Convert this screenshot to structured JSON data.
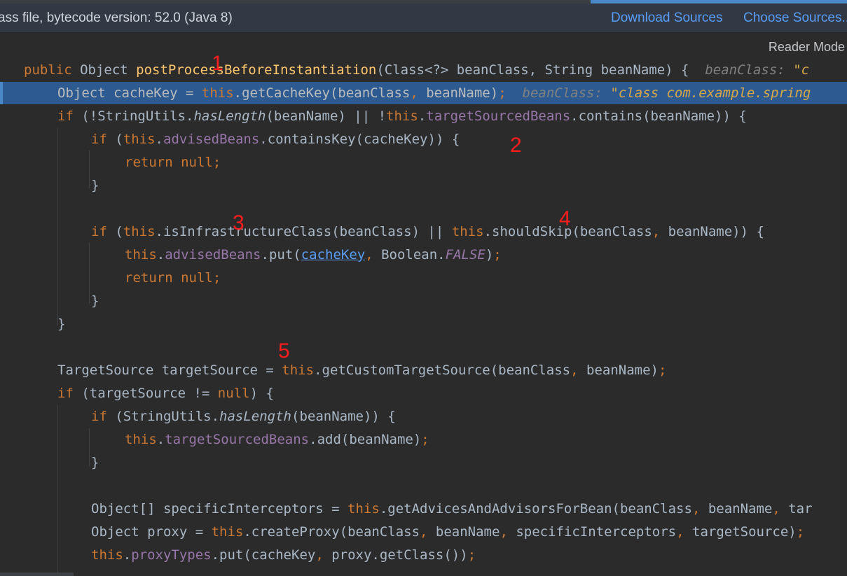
{
  "banner": {
    "text": "ass file, bytecode version: 52.0 (Java 8)",
    "download_sources": "Download Sources",
    "choose_sources": "Choose Sources..."
  },
  "editor": {
    "reader_mode": "Reader Mode",
    "hints": {
      "line1_label": "beanClass: ",
      "line1_value": "\"c",
      "line2_label": "beanClass: ",
      "line2_value": "\"class com.example.spring"
    }
  },
  "annotations": [
    "1",
    "2",
    "3",
    "4",
    "5"
  ],
  "code": {
    "l1": [
      "public",
      " Object ",
      "postProcessBeforeInstantiation",
      "(Class<?> beanClass, String beanName) {"
    ],
    "l2": [
      "Object cacheKey = ",
      "this",
      ".getCacheKey(beanClass",
      ",",
      " beanName)",
      ";"
    ],
    "l3": [
      "if",
      " (!StringUtils.",
      "hasLength",
      "(beanName) || !",
      "this",
      ".",
      "targetSourcedBeans",
      ".contains(beanName)) {"
    ],
    "l4": [
      "if",
      " (",
      "this",
      ".",
      "advisedBeans",
      ".containsKey(cacheKey)) {"
    ],
    "l5": [
      "return null",
      ";"
    ],
    "l6": "}",
    "l7": [
      "if",
      " (",
      "this",
      ".isInfrastructureClass(beanClass) || ",
      "this",
      ".shouldSkip(beanClass",
      ",",
      " beanName)) {"
    ],
    "l8": [
      "this",
      ".",
      "advisedBeans",
      ".put(",
      "cacheKey",
      ",",
      " Boolean.",
      "FALSE",
      ")",
      ";"
    ],
    "l9": [
      "return null",
      ";"
    ],
    "l10": "}",
    "l11": "}",
    "l12": [
      "TargetSource targetSource = ",
      "this",
      ".getCustomTargetSource(beanClass",
      ",",
      " beanName)",
      ";"
    ],
    "l13": [
      "if",
      " (targetSource != ",
      "null",
      ") {"
    ],
    "l14": [
      "if",
      " (StringUtils.",
      "hasLength",
      "(beanName)) {"
    ],
    "l15": [
      "this",
      ".",
      "targetSourcedBeans",
      ".add(beanName)",
      ";"
    ],
    "l16": "}",
    "l17": [
      "Object[] specificInterceptors = ",
      "this",
      ".getAdvicesAndAdvisorsForBean(beanClass",
      ",",
      " beanName",
      ",",
      " tar"
    ],
    "l18": [
      "Object proxy = ",
      "this",
      ".createProxy(beanClass",
      ",",
      " beanName",
      ",",
      " specificInterceptors",
      ",",
      " targetSource)",
      ";"
    ],
    "l19": [
      "this",
      ".",
      "proxyTypes",
      ".put(cacheKey",
      ",",
      " proxy.getClass())",
      ";"
    ]
  }
}
